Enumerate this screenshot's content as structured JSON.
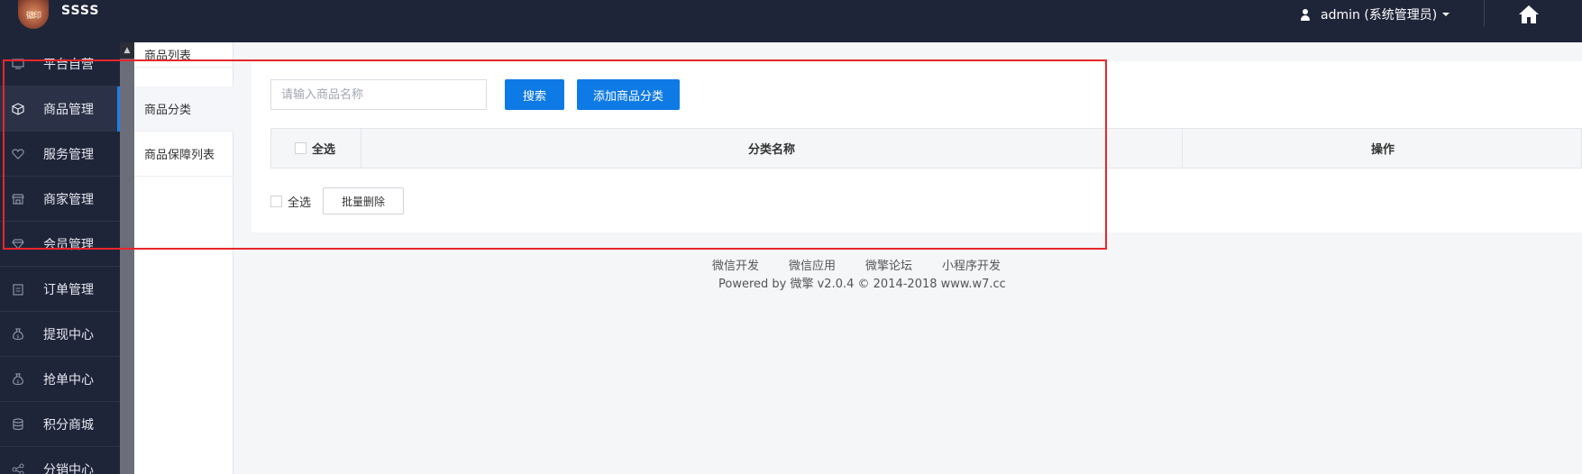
{
  "header": {
    "logo_text": "徽印",
    "site_name": "SSSS",
    "user_label": "admin (系统管理员)"
  },
  "sidebar": {
    "items": [
      {
        "label": "平台自营",
        "icon": "monitor-icon"
      },
      {
        "label": "商品管理",
        "icon": "cube-icon",
        "active": true
      },
      {
        "label": "服务管理",
        "icon": "heart-icon"
      },
      {
        "label": "商家管理",
        "icon": "store-icon"
      },
      {
        "label": "会员管理",
        "icon": "diamond-icon"
      },
      {
        "label": "订单管理",
        "icon": "clipboard-icon"
      },
      {
        "label": "提现中心",
        "icon": "money-bag-icon"
      },
      {
        "label": "抢单中心",
        "icon": "money-bag-icon"
      },
      {
        "label": "积分商城",
        "icon": "database-icon"
      },
      {
        "label": "分销中心",
        "icon": "share-icon"
      }
    ]
  },
  "submenu": {
    "items": [
      {
        "label": "商品列表"
      },
      {
        "label": "商品分类",
        "active": true
      },
      {
        "label": "商品保障列表"
      }
    ]
  },
  "search": {
    "placeholder": "请输入商品名称",
    "search_label": "搜索",
    "add_label": "添加商品分类"
  },
  "table": {
    "select_all": "全选",
    "col_name": "分类名称",
    "col_op": "操作"
  },
  "bulk": {
    "select_all": "全选",
    "delete_label": "批量删除"
  },
  "footer": {
    "links": [
      "微信开发",
      "微信应用",
      "微擎论坛",
      "小程序开发"
    ],
    "copyright": "Powered by 微擎 v2.0.4 © 2014-2018 www.w7.cc"
  },
  "colors": {
    "topbar": "#1f2539",
    "primary": "#0e7ae6",
    "annotation": "#e8262b"
  }
}
